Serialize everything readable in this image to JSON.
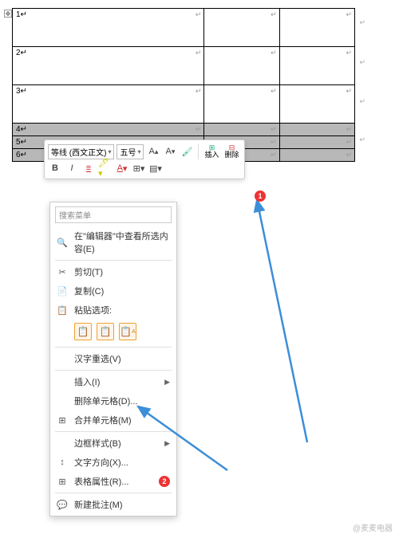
{
  "table": {
    "rows": [
      {
        "num": "1",
        "short": false
      },
      {
        "num": "2",
        "short": false
      },
      {
        "num": "3",
        "short": false
      },
      {
        "num": "4",
        "short": true
      },
      {
        "num": "5",
        "short": true
      },
      {
        "num": "6",
        "short": true
      }
    ]
  },
  "toolbar": {
    "font": "等线 (西文正文)",
    "size": "五号",
    "insert": "插入",
    "delete": "删除"
  },
  "menu": {
    "search_placeholder": "搜索菜单",
    "items": [
      {
        "icon": "🔍",
        "label": "在\"编辑器\"中查看所选内容(E)",
        "sub": false,
        "sep": false
      },
      {
        "sep": true
      },
      {
        "icon": "✂",
        "label": "剪切(T)",
        "sub": false,
        "sep": false
      },
      {
        "icon": "📄",
        "label": "复制(C)",
        "sub": false,
        "sep": false
      },
      {
        "icon": "📋",
        "label": "粘贴选项:",
        "sub": false,
        "sep": false,
        "paste": true
      },
      {
        "sep": true
      },
      {
        "icon": "",
        "label": "汉字重选(V)",
        "sub": false,
        "sep": false
      },
      {
        "sep": true
      },
      {
        "icon": "",
        "label": "插入(I)",
        "sub": true,
        "sep": false
      },
      {
        "icon": "",
        "label": "删除单元格(D)...",
        "sub": false,
        "sep": false
      },
      {
        "icon": "⊞",
        "label": "合并单元格(M)",
        "sub": false,
        "sep": false
      },
      {
        "sep": true
      },
      {
        "icon": "",
        "label": "边框样式(B)",
        "sub": true,
        "sep": false
      },
      {
        "icon": "↕",
        "label": "文字方向(X)...",
        "sub": false,
        "sep": false
      },
      {
        "icon": "⊞",
        "label": "表格属性(R)...",
        "sub": false,
        "sep": false,
        "badge": "2"
      },
      {
        "sep": true
      },
      {
        "icon": "💬",
        "label": "新建批注(M)",
        "sub": false,
        "sep": false
      }
    ]
  },
  "badges": {
    "one": "1",
    "two": "2"
  },
  "watermark": "@麦麦电器"
}
